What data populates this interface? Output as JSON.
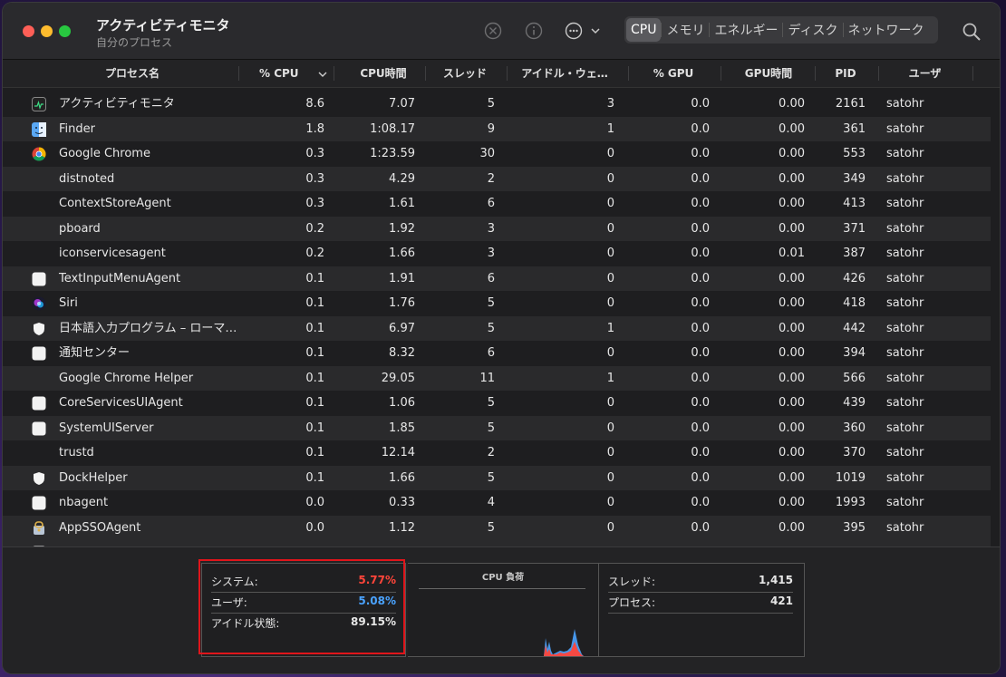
{
  "app": {
    "title": "アクティビティモニタ",
    "subtitle": "自分のプロセス"
  },
  "toolbar": {
    "icons": [
      "stop-process-icon",
      "info-icon",
      "more-actions-icon",
      "search-icon"
    ],
    "tabs": [
      "CPU",
      "メモリ",
      "エネルギー",
      "ディスク",
      "ネットワーク"
    ],
    "active_tab": "CPU"
  },
  "columns": [
    "プロセス名",
    "% CPU",
    "CPU時間",
    "スレッド",
    "アイドル・ウェ…",
    "% GPU",
    "GPU時間",
    "PID",
    "ユーザ"
  ],
  "processes": [
    {
      "name": "アクティビティモニタ",
      "cpu": "8.6",
      "cpu_time": "7.07",
      "threads": "5",
      "idle_wake": "3",
      "gpu": "0.0",
      "gpu_time": "0.00",
      "pid": "2161",
      "user": "satohr",
      "icon": "activity-monitor-icon"
    },
    {
      "name": "Finder",
      "cpu": "1.8",
      "cpu_time": "1:08.17",
      "threads": "9",
      "idle_wake": "1",
      "gpu": "0.0",
      "gpu_time": "0.00",
      "pid": "361",
      "user": "satohr",
      "icon": "finder-icon"
    },
    {
      "name": "Google Chrome",
      "cpu": "0.3",
      "cpu_time": "1:23.59",
      "threads": "30",
      "idle_wake": "0",
      "gpu": "0.0",
      "gpu_time": "0.00",
      "pid": "553",
      "user": "satohr",
      "icon": "chrome-icon"
    },
    {
      "name": "distnoted",
      "cpu": "0.3",
      "cpu_time": "4.29",
      "threads": "2",
      "idle_wake": "0",
      "gpu": "0.0",
      "gpu_time": "0.00",
      "pid": "349",
      "user": "satohr",
      "icon": ""
    },
    {
      "name": "ContextStoreAgent",
      "cpu": "0.3",
      "cpu_time": "1.61",
      "threads": "6",
      "idle_wake": "0",
      "gpu": "0.0",
      "gpu_time": "0.00",
      "pid": "413",
      "user": "satohr",
      "icon": ""
    },
    {
      "name": "pboard",
      "cpu": "0.2",
      "cpu_time": "1.92",
      "threads": "3",
      "idle_wake": "0",
      "gpu": "0.0",
      "gpu_time": "0.00",
      "pid": "371",
      "user": "satohr",
      "icon": ""
    },
    {
      "name": "iconservicesagent",
      "cpu": "0.2",
      "cpu_time": "1.66",
      "threads": "3",
      "idle_wake": "0",
      "gpu": "0.0",
      "gpu_time": "0.01",
      "pid": "387",
      "user": "satohr",
      "icon": ""
    },
    {
      "name": "TextInputMenuAgent",
      "cpu": "0.1",
      "cpu_time": "1.91",
      "threads": "6",
      "idle_wake": "0",
      "gpu": "0.0",
      "gpu_time": "0.00",
      "pid": "426",
      "user": "satohr",
      "icon": "generic-app-icon"
    },
    {
      "name": "Siri",
      "cpu": "0.1",
      "cpu_time": "1.76",
      "threads": "5",
      "idle_wake": "0",
      "gpu": "0.0",
      "gpu_time": "0.00",
      "pid": "418",
      "user": "satohr",
      "icon": "siri-icon"
    },
    {
      "name": "日本語入力プログラム – ローマ…",
      "cpu": "0.1",
      "cpu_time": "6.97",
      "threads": "5",
      "idle_wake": "1",
      "gpu": "0.0",
      "gpu_time": "0.00",
      "pid": "442",
      "user": "satohr",
      "icon": "shield-icon"
    },
    {
      "name": "通知センター",
      "cpu": "0.1",
      "cpu_time": "8.32",
      "threads": "6",
      "idle_wake": "0",
      "gpu": "0.0",
      "gpu_time": "0.00",
      "pid": "394",
      "user": "satohr",
      "icon": "generic-app-icon"
    },
    {
      "name": "Google Chrome Helper",
      "cpu": "0.1",
      "cpu_time": "29.05",
      "threads": "11",
      "idle_wake": "1",
      "gpu": "0.0",
      "gpu_time": "0.00",
      "pid": "566",
      "user": "satohr",
      "icon": ""
    },
    {
      "name": "CoreServicesUIAgent",
      "cpu": "0.1",
      "cpu_time": "1.06",
      "threads": "5",
      "idle_wake": "0",
      "gpu": "0.0",
      "gpu_time": "0.00",
      "pid": "439",
      "user": "satohr",
      "icon": "generic-app-icon"
    },
    {
      "name": "SystemUIServer",
      "cpu": "0.1",
      "cpu_time": "1.85",
      "threads": "5",
      "idle_wake": "0",
      "gpu": "0.0",
      "gpu_time": "0.00",
      "pid": "360",
      "user": "satohr",
      "icon": "generic-app-icon"
    },
    {
      "name": "trustd",
      "cpu": "0.1",
      "cpu_time": "12.14",
      "threads": "2",
      "idle_wake": "0",
      "gpu": "0.0",
      "gpu_time": "0.00",
      "pid": "370",
      "user": "satohr",
      "icon": ""
    },
    {
      "name": "DockHelper",
      "cpu": "0.1",
      "cpu_time": "1.66",
      "threads": "5",
      "idle_wake": "0",
      "gpu": "0.0",
      "gpu_time": "0.00",
      "pid": "1019",
      "user": "satohr",
      "icon": "shield-icon"
    },
    {
      "name": "nbagent",
      "cpu": "0.0",
      "cpu_time": "0.33",
      "threads": "4",
      "idle_wake": "0",
      "gpu": "0.0",
      "gpu_time": "0.00",
      "pid": "1993",
      "user": "satohr",
      "icon": "generic-app-icon"
    },
    {
      "name": "AppSSOAgent",
      "cpu": "0.0",
      "cpu_time": "1.12",
      "threads": "5",
      "idle_wake": "0",
      "gpu": "0.0",
      "gpu_time": "0.00",
      "pid": "395",
      "user": "satohr",
      "icon": "app-sso-icon"
    }
  ],
  "summary": {
    "system_label": "システム:",
    "system_value": "5.77%",
    "user_label": "ユーザ:",
    "user_value": "5.08%",
    "idle_label": "アイドル状態:",
    "idle_value": "89.15%",
    "cpu_load_title": "CPU 負荷",
    "threads_label": "スレッド:",
    "threads_value": "1,415",
    "processes_label": "プロセス:",
    "processes_value": "421"
  },
  "colors": {
    "system": "#ff453a",
    "user": "#4aa3ff",
    "highlight": "#e0151b"
  }
}
